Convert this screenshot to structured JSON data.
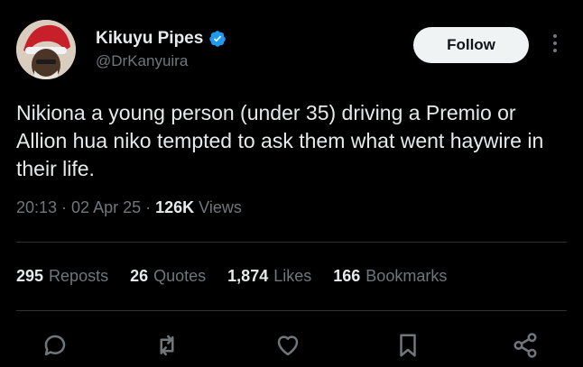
{
  "author": {
    "name": "Kikuyu Pipes",
    "handle": "@DrKanyuira",
    "verified": true,
    "avatar_icon": "avatar-santa-hat-icon"
  },
  "follow_label": "Follow",
  "tweet": {
    "text": "Nikiona a young person (under 35) driving a Premio or Allion hua niko tempted to ask them what went haywire in their life.",
    "time": "20:13",
    "date": "02 Apr 25",
    "views_count": "126K",
    "views_label": "Views"
  },
  "stats": [
    {
      "count": "295",
      "label": "Reposts"
    },
    {
      "count": "26",
      "label": "Quotes"
    },
    {
      "count": "1,874",
      "label": "Likes"
    },
    {
      "count": "166",
      "label": "Bookmarks"
    }
  ],
  "actions": [
    "reply-icon",
    "repost-icon",
    "like-icon",
    "bookmark-icon",
    "share-icon"
  ],
  "colors": {
    "background": "#000000",
    "text": "#e7e9ea",
    "secondary": "#71767b",
    "verified": "#1d9bf0",
    "divider": "#2f3336"
  }
}
